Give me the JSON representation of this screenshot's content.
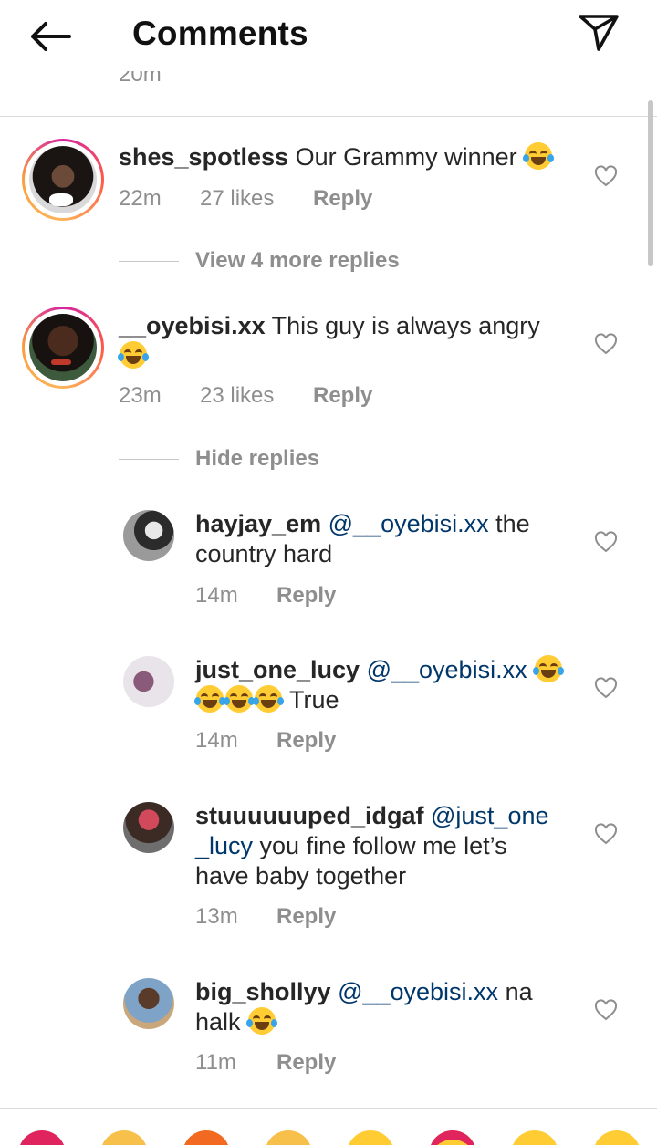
{
  "header": {
    "title": "Comments"
  },
  "cut_time": "20m",
  "comments": [
    {
      "username": "shes_spotless",
      "text": "Our Grammy winner",
      "time": "22m",
      "likes": "27 likes",
      "reply": "Reply",
      "view_more": "View 4 more replies"
    },
    {
      "username": "__oyebisi.xx",
      "text": "This guy is always angry",
      "time": "23m",
      "likes": "23 likes",
      "reply": "Reply",
      "hide": "Hide replies"
    }
  ],
  "replies": [
    {
      "username": "hayjay_em",
      "mention": "@__oyebisi.xx",
      "text_a": " the",
      "text_b": "country hard",
      "time": "14m",
      "reply": "Reply"
    },
    {
      "username": "just_one_lucy",
      "mention": "@__oyebisi.xx",
      "text_b": " True",
      "time": "14m",
      "reply": "Reply"
    },
    {
      "username": "stuuuuuuped_idgaf",
      "mention_a": "@just_one",
      "mention_b": "_lucy",
      "text_a": " you fine follow me let’s",
      "text_b": "have baby together",
      "time": "13m",
      "reply": "Reply"
    },
    {
      "username": "big_shollyy",
      "mention": "@__oyebisi.xx",
      "text_a": " na",
      "text_b": "halk",
      "time": "11m",
      "reply": "Reply"
    }
  ],
  "icons": {
    "back": "back-arrow-icon",
    "send": "paper-plane-icon",
    "like": "heart-outline-icon",
    "emoji": "face-with-tears-of-joy-emoji"
  },
  "reactions": [
    "red-heart",
    "raising-hands",
    "fire",
    "clapping-hands",
    "crying-laughing-face",
    "heart-eyes-face",
    "surprised-face",
    "crying-laughing-face"
  ]
}
